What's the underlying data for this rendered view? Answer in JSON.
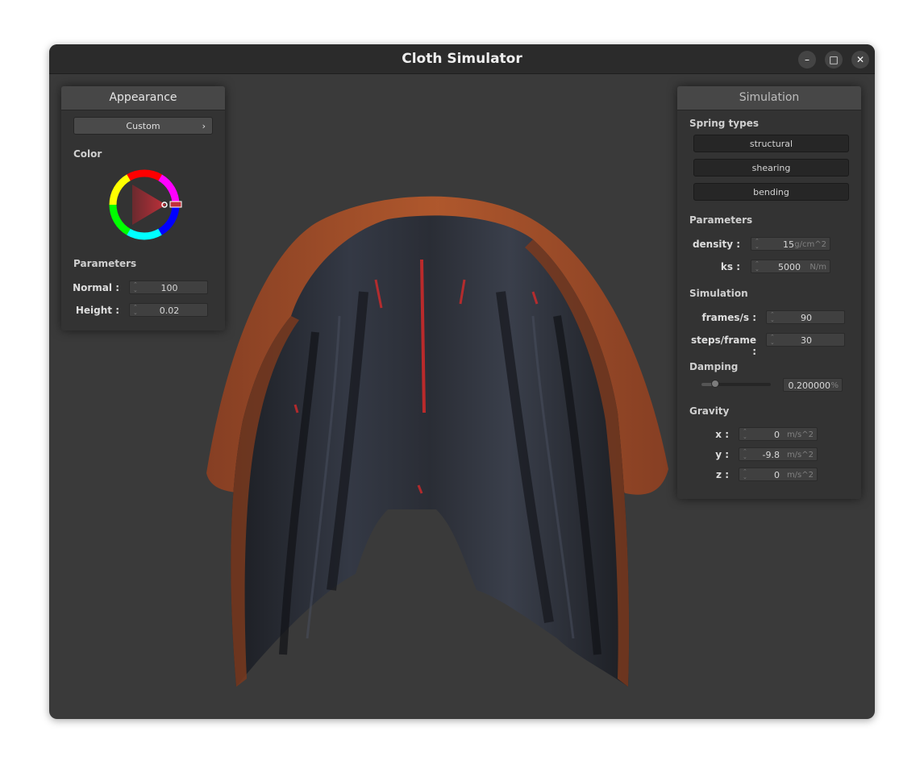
{
  "window": {
    "title": "Cloth Simulator",
    "minimize_glyph": "–",
    "maximize_glyph": "□",
    "close_glyph": "✕"
  },
  "appearance": {
    "title": "Appearance",
    "preset": {
      "value": "Custom",
      "chevron": "›"
    },
    "color_label": "Color",
    "parameters_label": "Parameters",
    "fields": [
      {
        "label": "Normal :",
        "value": "100"
      },
      {
        "label": "Height :",
        "value": "0.02"
      }
    ]
  },
  "simulation": {
    "title": "Simulation",
    "spring_types_label": "Spring types",
    "spring_types": [
      "structural",
      "shearing",
      "bending"
    ],
    "parameters_label": "Parameters",
    "parameters": [
      {
        "label": "density :",
        "value": "15",
        "unit": "g/cm^2"
      },
      {
        "label": "ks :",
        "value": "5000",
        "unit": "N/m"
      }
    ],
    "simulation_label": "Simulation",
    "simulation_fields": [
      {
        "label": "frames/s :",
        "value": "90"
      },
      {
        "label": "steps/frame :",
        "value": "30"
      }
    ],
    "damping_label": "Damping",
    "damping": {
      "value": "0.200000",
      "unit": "%",
      "slider_fraction": 0.2
    },
    "gravity_label": "Gravity",
    "gravity": [
      {
        "label": "x :",
        "value": "0",
        "unit": "m/s^2"
      },
      {
        "label": "y :",
        "value": "-9.8",
        "unit": "m/s^2"
      },
      {
        "label": "z :",
        "value": "0",
        "unit": "m/s^2"
      }
    ]
  },
  "colors": {
    "window_bg": "#3a3a3a",
    "titlebar_bg": "#2b2b2b",
    "panel_bg": "#333333",
    "selected_color": "#c0303a",
    "cloth_dark": "#22252c",
    "cloth_copper": "#a04a26"
  },
  "icons": {
    "minimize": "minimize-icon",
    "maximize": "maximize-icon",
    "close": "close-icon",
    "spinner": "spinner-arrows-icon",
    "chevron": "chevron-right-icon"
  }
}
